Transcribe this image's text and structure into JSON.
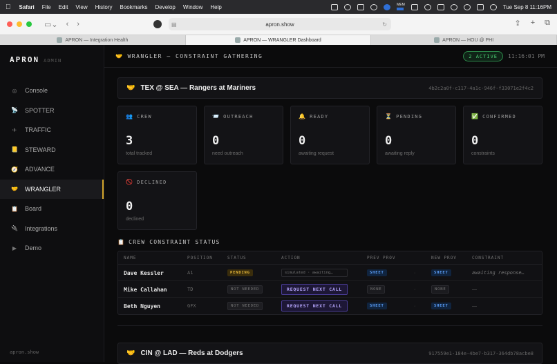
{
  "menubar": {
    "app": "Safari",
    "items": [
      "File",
      "Edit",
      "View",
      "History",
      "Bookmarks",
      "Develop",
      "Window",
      "Help"
    ],
    "mem_label": "MEM",
    "datetime": "Tue Sep 8  11:16PM"
  },
  "browser": {
    "url": "apron.show",
    "tabs": [
      {
        "label": "APRON — Integration Health",
        "active": false
      },
      {
        "label": "APRON — WRANGLER Dashboard",
        "active": true
      },
      {
        "label": "APRON — HOU @ PHI",
        "active": false
      }
    ]
  },
  "sidebar": {
    "brand": "APRON",
    "role": "ADMIN",
    "items": [
      {
        "label": "Console",
        "icon": "circle-icon",
        "glyph": "◎"
      },
      {
        "label": "SPOTTER",
        "icon": "satellite-icon",
        "glyph": "📡"
      },
      {
        "label": "TRAFFIC",
        "icon": "plane-icon",
        "glyph": "✈"
      },
      {
        "label": "STEWARD",
        "icon": "ledger-icon",
        "glyph": "📒"
      },
      {
        "label": "ADVANCE",
        "icon": "compass-icon",
        "glyph": "🧭"
      },
      {
        "label": "WRANGLER",
        "icon": "handshake-icon",
        "glyph": "🤝"
      },
      {
        "label": "Board",
        "icon": "clipboard-icon",
        "glyph": "📋"
      },
      {
        "label": "Integrations",
        "icon": "plug-icon",
        "glyph": "🔌"
      },
      {
        "label": "Demo",
        "icon": "play-icon",
        "glyph": "▶"
      }
    ],
    "active_index": 5,
    "footer": "apron.show"
  },
  "header": {
    "title": "WRANGLER — CONSTRAINT GATHERING",
    "title_icon": "🤝",
    "active_badge": "2 ACTIVE",
    "clock": "11:16:01 PM"
  },
  "games": [
    {
      "title": "TEX @ SEA — Rangers at Mariners",
      "id": "4b2c2a0f-c117-4a1c-946f-f33071e2f4c2",
      "icon": "🤝"
    },
    {
      "title": "CIN @ LAD — Reds at Dodgers",
      "id": "917559e1-184e-4be7-b317-364db78acbe8",
      "icon": "🤝"
    }
  ],
  "stats": [
    {
      "label": "CREW",
      "icon": "👥",
      "value": "3",
      "sub": "total tracked"
    },
    {
      "label": "OUTREACH",
      "icon": "📨",
      "value": "0",
      "sub": "need outreach"
    },
    {
      "label": "READY",
      "icon": "🔔",
      "value": "0",
      "sub": "awaiting request"
    },
    {
      "label": "PENDING",
      "icon": "⏳",
      "value": "0",
      "sub": "awaiting reply"
    },
    {
      "label": "CONFIRMED",
      "icon": "✅",
      "value": "0",
      "sub": "constraints"
    },
    {
      "label": "DECLINED",
      "icon": "🚫",
      "value": "0",
      "sub": "declined"
    }
  ],
  "crew_section": {
    "title": "CREW CONSTRAINT STATUS",
    "icon": "📋",
    "columns": [
      "NAME",
      "POSITION",
      "STATUS",
      "ACTION",
      "PREV PROV",
      "NEW PROV",
      "CONSTRAINT"
    ],
    "rows": [
      {
        "name": "Dave Kessler",
        "position": "A1",
        "status": "PENDING",
        "action": "simulated · awaiting…",
        "action_type": "simulated",
        "sep": "·",
        "prev": "SHEET",
        "new": "SHEET",
        "constraint": "awaiting response…"
      },
      {
        "name": "Mike Callahan",
        "position": "TD",
        "status": "NOT NEEDED",
        "action": "REQUEST NEXT CALL",
        "action_type": "button",
        "sep": "·",
        "prev": "NONE",
        "new": "NONE",
        "constraint": "—"
      },
      {
        "name": "Beth Nguyen",
        "position": "GFX",
        "status": "NOT NEEDED",
        "action": "REQUEST NEXT CALL",
        "action_type": "button",
        "sep": "·",
        "prev": "SHEET",
        "new": "SHEET",
        "constraint": "—"
      }
    ]
  },
  "colors": {
    "accent": "#d4a52a",
    "active_green": "#4ccf75",
    "pending": "#e5b73b",
    "sheet_blue": "#5fa3ff",
    "request_purple": "#b7a7ff"
  }
}
